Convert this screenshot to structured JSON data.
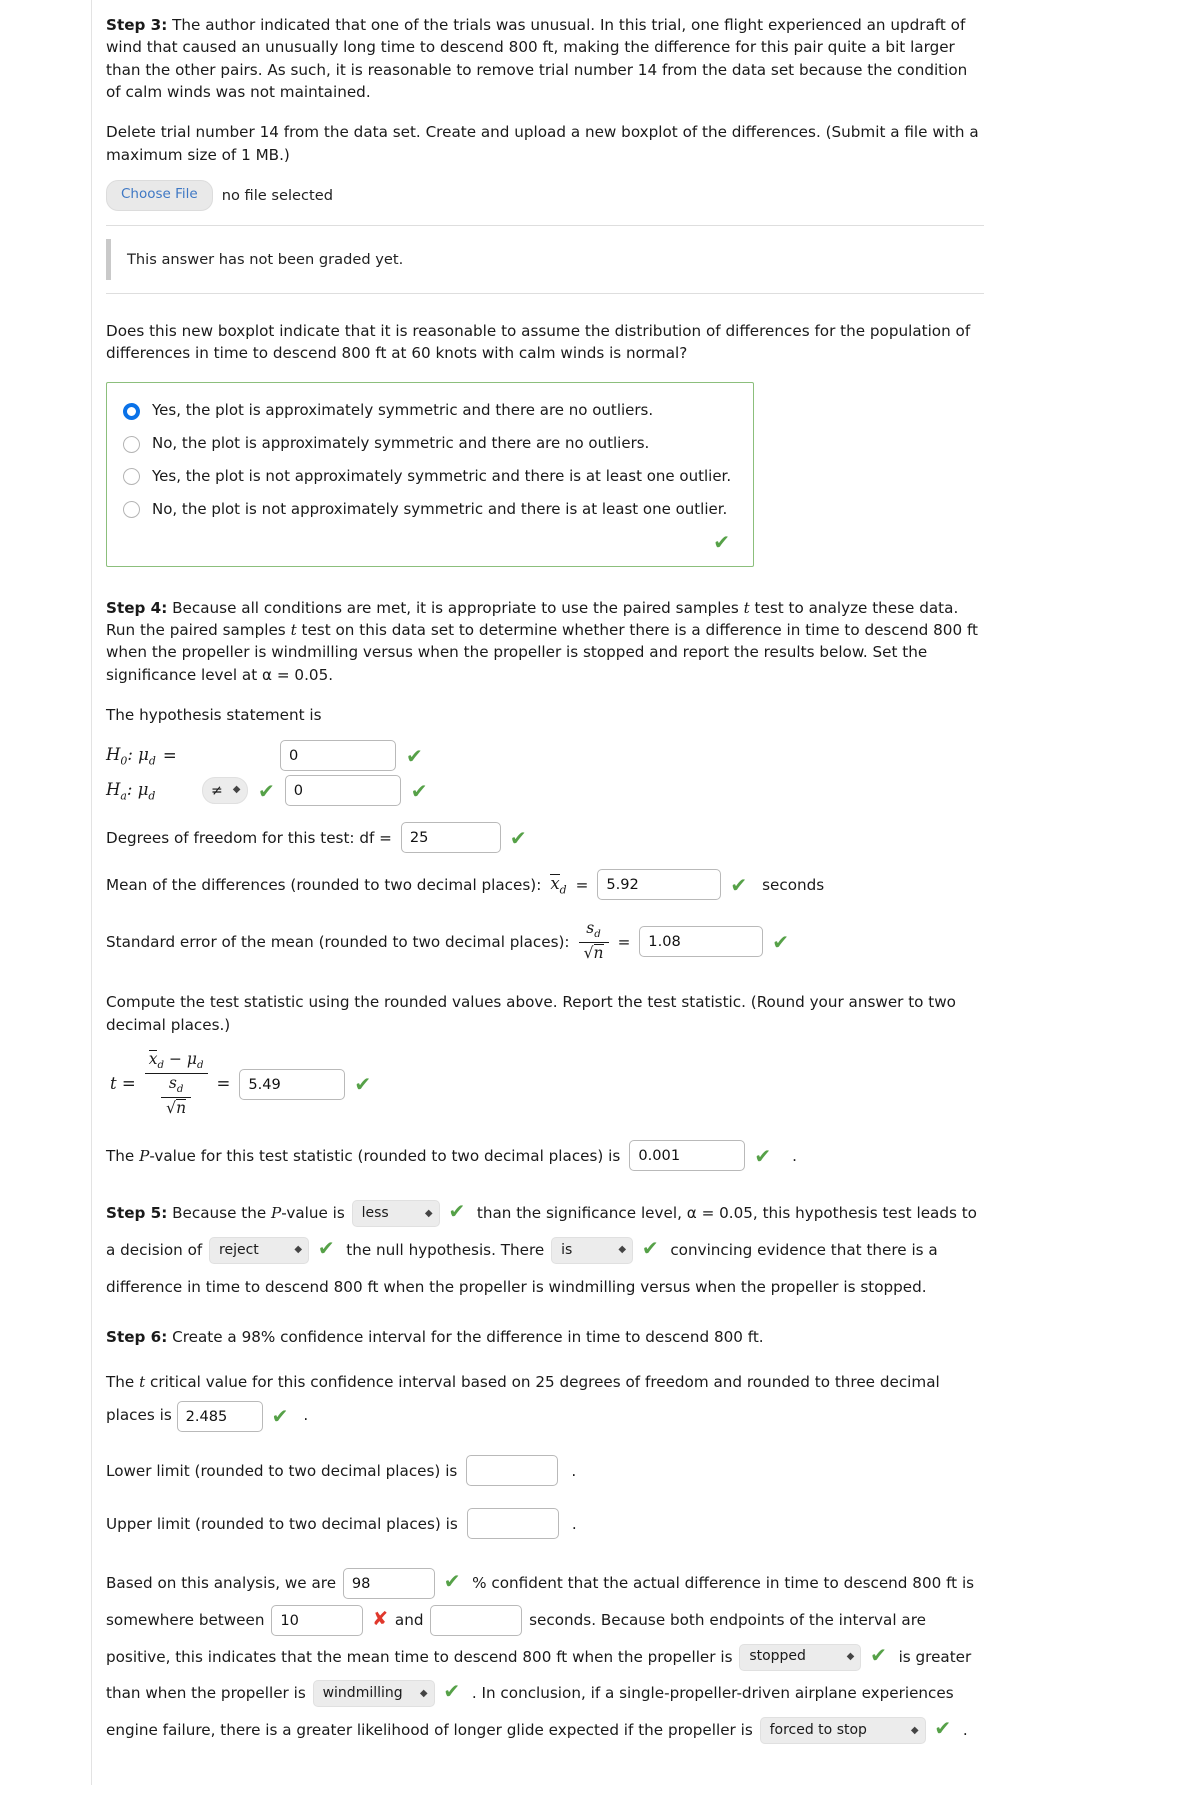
{
  "step3": {
    "label": "Step 3:",
    "body": " The author indicated that one of the trials was unusual. In this trial, one flight experienced an updraft of wind that caused an unusually long time to descend 800 ft, making the difference for this pair quite a bit larger than the other pairs. As such, it is reasonable to remove trial number 14 from the data set because the condition of calm winds was not maintained.",
    "upload_instruction": "Delete trial number 14 from the data set. Create and upload a new boxplot of the differences. (Submit a file with a maximum size of 1 MB.)",
    "choose_file_label": "Choose File",
    "no_file_text": "no file selected",
    "grading_notice": "This answer has not been graded yet."
  },
  "boxplot_question": {
    "prompt": "Does this new boxplot indicate that it is reasonable to assume the distribution of differences for the population of differences in time to descend 800 ft at 60 knots with calm winds is normal?",
    "options": [
      {
        "label": "Yes, the plot is approximately symmetric and there are no outliers.",
        "selected": true
      },
      {
        "label": "No, the plot is approximately symmetric and there are no outliers.",
        "selected": false
      },
      {
        "label": "Yes, the plot is not approximately symmetric and there is at least one outlier.",
        "selected": false
      },
      {
        "label": "No, the plot is not approximately symmetric and there is at least one outlier.",
        "selected": false
      }
    ],
    "correct_mark": "✔",
    "border_color": "#8cbf7c"
  },
  "step4": {
    "label": "Step 4:",
    "body_1": " Because all conditions are met, it is appropriate to use the paired samples ",
    "body_t": "t",
    "body_2": " test to analyze these data. Run the paired samples ",
    "body_3": " test on this data set to determine whether there is a difference in time to descend 800 ft when the propeller is windmilling versus when the propeller is stopped and report the results below. Set the significance level at α = 0.05.",
    "hypothesis_heading": "The hypothesis statement is",
    "h0_prefix": "H",
    "h0_sub": "0",
    "h0_mu": "μ",
    "h0_mu_sub": "d",
    "h0_operator": "=",
    "h0_value": "0",
    "ha_prefix": "H",
    "ha_sub": "a",
    "ha_mu": "μ",
    "ha_mu_sub": "d",
    "ha_operator_selected": "≠",
    "ha_value": "0",
    "df_label": "Degrees of freedom for this test: df =",
    "df_value": "25",
    "mean_label": "Mean of the differences (rounded to two decimal places):",
    "mean_symbol_x": "x",
    "mean_symbol_sub": "d",
    "mean_equals": "=",
    "mean_value": "5.92",
    "mean_units": "seconds",
    "sem_label": "Standard error of the mean (rounded to two decimal places):",
    "sem_num": "s",
    "sem_num_sub": "d",
    "sem_den_radicand": "n",
    "sem_equals": "=",
    "sem_value": "1.08"
  },
  "test_statistic": {
    "instruction": "Compute the test statistic using the rounded values above. Report the test statistic. (Round your answer to two decimal places.)",
    "t_label": "t",
    "t_equals": "=",
    "num_x": "x",
    "num_x_sub": "d",
    "num_minus": "−",
    "num_mu": "μ",
    "num_mu_sub": "d",
    "den_s": "s",
    "den_s_sub": "d",
    "den_radicand": "n",
    "result_equals": "=",
    "value": "5.49"
  },
  "pvalue": {
    "prefix": "The ",
    "p_italic": "P",
    "text": "-value for this test statistic (rounded to two decimal places) is",
    "value": "0.001",
    "period": "."
  },
  "step5": {
    "label": "Step 5:",
    "seg1": " Because the ",
    "p_italic": "P",
    "seg2": "-value is",
    "dropdown_1": "less",
    "seg3": "than the significance level, α = 0.05, this hypothesis test",
    "seg4": "leads to a decision of",
    "dropdown_2": "reject",
    "seg5": "the null hypothesis. There",
    "dropdown_3": "is",
    "seg6": "convincing evidence",
    "seg7": "that there is a difference in time to descend 800 ft when the propeller is windmilling versus when the propeller is stopped."
  },
  "step6": {
    "label": "Step 6:",
    "body": " Create a 98% confidence interval for the difference in time to descend 800 ft.",
    "tcrit_seg1": "The ",
    "tcrit_italic": "t",
    "tcrit_seg2": " critical value for this confidence interval based on 25 degrees of freedom and rounded to three decimal places is",
    "tcrit_value": "2.485",
    "tcrit_period": ".",
    "lower_label": "Lower limit (rounded to two decimal places) is",
    "lower_value": "",
    "lower_period": ".",
    "upper_label": "Upper limit (rounded to two decimal places) is",
    "upper_value": "",
    "upper_period": "."
  },
  "conclusion": {
    "seg1": "Based on this analysis, we are",
    "confidence_value": "98",
    "seg2": "% confident that the actual difference in time to descend",
    "seg3": "800 ft is somewhere between",
    "lower_value": "10",
    "seg4": "and",
    "upper_value": "",
    "seg5": "seconds. Because both endpoints of the",
    "seg6": "interval are positive, this indicates that the mean time to descend 800 ft when the propeller is",
    "dropdown_prop1": "stopped",
    "seg7": "is greater than when the propeller is",
    "dropdown_prop2": "windmilling",
    "seg8": ". In conclusion, if a single-propeller-driven",
    "seg9": "airplane experiences engine failure, there is a greater likelihood of longer glide expected if the propeller is",
    "dropdown_prop3": "forced to stop",
    "seg10": "."
  },
  "icons": {
    "check": "✔",
    "cross": "✘",
    "chevron_updown": "⌃⌄"
  },
  "colors": {
    "check_green": "#56a148",
    "cross_red": "#e0382c",
    "radio_blue": "#0a72e8",
    "link_blue": "#3f78c4",
    "group_border_green": "#8cbf7c"
  }
}
